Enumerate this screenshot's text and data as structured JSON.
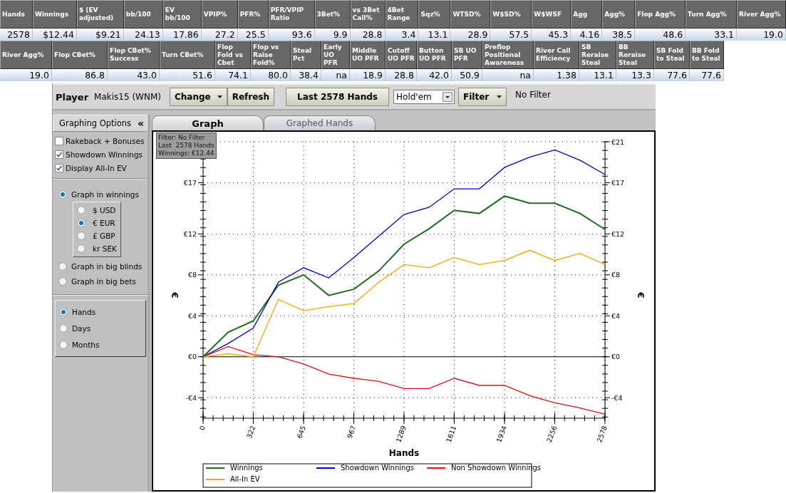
{
  "stat_rows": [
    {
      "cells": [
        {
          "header": "Hands",
          "value": "2578"
        },
        {
          "header": "Winnings",
          "value": "$12.44"
        },
        {
          "header": "$ (EV adjusted)",
          "value": "$9.21"
        },
        {
          "header": "bb/100",
          "value": "24.13"
        },
        {
          "header": "EV bb/100",
          "value": "17.86"
        },
        {
          "header": "VPIP%",
          "value": "27.2"
        },
        {
          "header": "PFR%",
          "value": "25.5"
        },
        {
          "header": "PFR/VPIP Ratio",
          "value": "93.6"
        },
        {
          "header": "3Bet%",
          "value": "9.9"
        },
        {
          "header": "vs 3Bet Call%",
          "value": "28.8"
        },
        {
          "header": "4Bet Range",
          "value": "3.4"
        },
        {
          "header": "Sqz%",
          "value": "13.1"
        },
        {
          "header": "WTSD%",
          "value": "28.9"
        },
        {
          "header": "W$SD%",
          "value": "57.5"
        },
        {
          "header": "W$WSF",
          "value": "45.3"
        },
        {
          "header": "Agg",
          "value": "4.16"
        },
        {
          "header": "Agg%",
          "value": "38.5"
        },
        {
          "header": "Flop Agg%",
          "value": "48.6"
        },
        {
          "header": "Turn Agg%",
          "value": "33.1"
        },
        {
          "header": "River Agg%",
          "value": "19.0"
        }
      ]
    },
    {
      "cells": [
        {
          "header": "River Agg%",
          "value": "19.0"
        },
        {
          "header": "Flop CBet%",
          "value": "86.8"
        },
        {
          "header": "Flop CBet% Success",
          "value": "43.0"
        },
        {
          "header": "Turn CBet%",
          "value": "51.6"
        },
        {
          "header": "Flop Fold vs Cbet",
          "value": "74.1"
        },
        {
          "header": "Flop vs Raise Fold%",
          "value": "80.0"
        },
        {
          "header": "Steal Pct",
          "value": "38.4"
        },
        {
          "header": "Early UO PFR",
          "value": "na"
        },
        {
          "header": "Middle UO PFR",
          "value": "18.9"
        },
        {
          "header": "Cutoff UO PFR",
          "value": "28.8"
        },
        {
          "header": "Button UO PFR",
          "value": "42.0"
        },
        {
          "header": "SB UO PFR",
          "value": "50.9"
        },
        {
          "header": "Preflop Positional Awareness",
          "value": "na"
        },
        {
          "header": "River Call Efficiency",
          "value": "1.38"
        },
        {
          "header": "SB Reraise Steal",
          "value": "13.1"
        },
        {
          "header": "BB Reraise Steal",
          "value": "13.3"
        },
        {
          "header": "SB Fold to Steal",
          "value": "77.6"
        },
        {
          "header": "BB Fold to Steal",
          "value": "77.6"
        }
      ]
    }
  ],
  "toolbar": {
    "player_label": "Player",
    "player": "Makis15 (WNM)",
    "buttons": [
      {
        "label": "Change",
        "dropdown": true
      },
      {
        "label": "Refresh",
        "dropdown": false
      }
    ],
    "range_button": "Last 2578 Hands",
    "game_select": "Hold'em",
    "filter_button": {
      "label": "Filter",
      "dropdown": true
    },
    "filter_status": "No Filter"
  },
  "sidebar": {
    "title": "Graphing Options",
    "collapse_glyph": "«",
    "checkboxes": [
      {
        "label": "Rakeback + Bonuses",
        "checked": false
      },
      {
        "label": "Showdown Winnings",
        "checked": true
      },
      {
        "label": "Display All-In EV",
        "checked": true
      }
    ],
    "graph_modes": [
      {
        "label": "Graph in winnings",
        "selected": true,
        "currencies": [
          {
            "label": "$ USD",
            "selected": false
          },
          {
            "label": "€ EUR",
            "selected": true
          },
          {
            "label": "£ GBP",
            "selected": false
          },
          {
            "label": "kr SEK",
            "selected": false
          }
        ]
      },
      {
        "label": "Graph in big blinds",
        "selected": false
      },
      {
        "label": "Graph in big bets",
        "selected": false
      }
    ],
    "x_axis_modes": [
      {
        "label": "Hands",
        "selected": true
      },
      {
        "label": "Days",
        "selected": false
      },
      {
        "label": "Months",
        "selected": false
      }
    ]
  },
  "tabs": [
    {
      "label": "Graph",
      "selected": true
    },
    {
      "label": "Graphed Hands",
      "selected": false
    }
  ],
  "chart": {
    "info_box": [
      "Filter: No Filter",
      "Last  2578 Hands",
      "Winnings: €12.44"
    ],
    "ylabel_right": "€",
    "chart_data": {
      "type": "line",
      "xlabel": "Hands",
      "ylabel": "€",
      "x": [
        0,
        161,
        322,
        483,
        645,
        806,
        967,
        1128,
        1289,
        1450,
        1611,
        1772,
        1934,
        2095,
        2256,
        2417,
        2578
      ],
      "series": [
        {
          "name": "Winnings",
          "color": "#1e6b1e",
          "values": [
            0,
            2.4,
            3.5,
            7,
            8,
            6,
            6.6,
            8.4,
            11,
            12.5,
            14.3,
            14,
            15.7,
            15,
            15,
            14,
            12.44
          ]
        },
        {
          "name": "Showdown Winnings",
          "color": "#0000cc",
          "values": [
            0,
            1.3,
            2.8,
            7.3,
            8.7,
            7.7,
            9.7,
            11.8,
            13.9,
            14.6,
            16.4,
            16.4,
            18.5,
            19.5,
            20.2,
            19.2,
            17.8
          ]
        },
        {
          "name": "Non Showdown Winnings",
          "color": "#dd1111",
          "values": [
            0,
            1,
            0.2,
            0,
            -0.7,
            -1.7,
            -2.1,
            -2.4,
            -3.1,
            -3.1,
            -2.1,
            -2.8,
            -2.8,
            -3.8,
            -4.5,
            -5,
            -5.6
          ]
        },
        {
          "name": "All-In EV",
          "color": "#f5a500",
          "values": [
            0,
            0.3,
            0,
            5.6,
            4.5,
            4.9,
            5.2,
            7.3,
            9,
            8.7,
            9.7,
            9,
            9.4,
            10.4,
            9.4,
            10.1,
            9
          ]
        }
      ],
      "xlim": [
        0,
        2578
      ],
      "ylim": [
        -6,
        21
      ],
      "xticks": [
        {
          "value": 0,
          "label": "0"
        },
        {
          "value": 322,
          "label": "322"
        },
        {
          "value": 645,
          "label": "645"
        },
        {
          "value": 967,
          "label": "967"
        },
        {
          "value": 1289,
          "label": "1289"
        },
        {
          "value": 1611,
          "label": "1611"
        },
        {
          "value": 1934,
          "label": "1934"
        },
        {
          "value": 2256,
          "label": "2256"
        },
        {
          "value": 2578,
          "label": "2578"
        }
      ],
      "yticks": [
        {
          "value": -4,
          "label": "-€4"
        },
        {
          "value": 0,
          "label": "€0"
        },
        {
          "value": 4,
          "label": "€4"
        },
        {
          "value": 8,
          "label": "€8"
        },
        {
          "value": 12,
          "label": "€12"
        },
        {
          "value": 17,
          "label": "€17"
        },
        {
          "value": 21,
          "label": "€21"
        }
      ],
      "grid": true,
      "legend": true
    }
  }
}
